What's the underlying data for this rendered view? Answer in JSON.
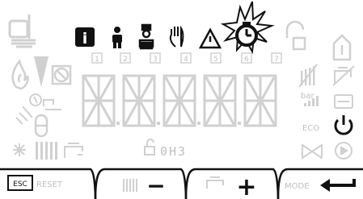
{
  "display": {
    "info_label": "i",
    "slot_numbers": [
      "1",
      "2",
      "3",
      "4",
      "5",
      "6",
      "7"
    ],
    "code_text": "0H3",
    "pressure_unit": "bar",
    "eco_label": "ECO"
  },
  "buttons": {
    "esc_label": "ESC",
    "reset_label": "RESET",
    "minus_label": "−",
    "plus_label": "+",
    "mode_label": "MODE"
  },
  "colors": {
    "active": "#111111",
    "inactive": "#d0d0d0",
    "background": "#ffffff"
  },
  "icons": {
    "top_row": [
      "info-icon",
      "person-icon",
      "service-person-icon",
      "hand-icon",
      "warning-triangle-icon",
      "clock-timer-icon"
    ],
    "left_column": [
      "flame-modulation-icon",
      "triangle-bars-icon",
      "circle-slash-icon",
      "sun-heat-icon",
      "tap-icon",
      "water-drop-icon",
      "snowflake-icon",
      "radiator-icon",
      "shower-tap-icon"
    ],
    "right_column": [
      "house-thermometer-icon",
      "radiator-off-icon",
      "pressure-bars-icon",
      "heater-box-icon",
      "power-icon",
      "valve-icon",
      "play-icon"
    ]
  }
}
